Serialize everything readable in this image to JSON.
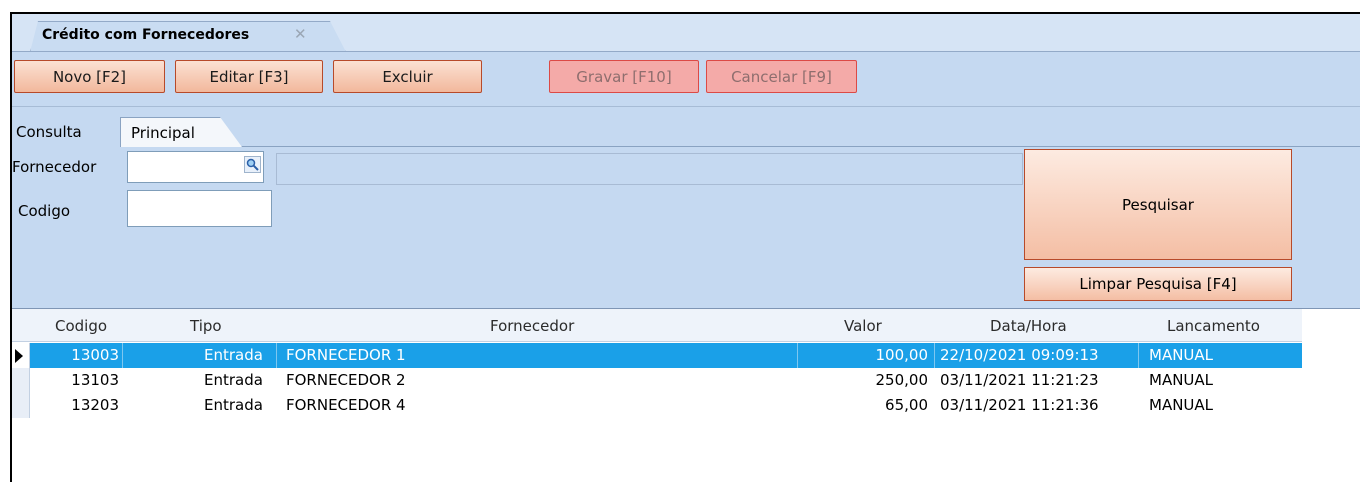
{
  "document_tab": {
    "title": "Crédito com Fornecedores",
    "close_glyph": "✕"
  },
  "toolbar": {
    "novo": "Novo [F2]",
    "editar": "Editar [F3]",
    "excluir": "Excluir",
    "gravar": "Gravar [F10]",
    "cancelar": "Cancelar [F9]"
  },
  "subtabs": {
    "consulta": "Consulta",
    "principal": "Principal"
  },
  "search": {
    "fornecedor_label": "Fornecedor",
    "fornecedor_value": "",
    "codigo_label": "Codigo",
    "codigo_value": "",
    "pesquisar": "Pesquisar",
    "limpar": "Limpar Pesquisa [F4]"
  },
  "grid": {
    "columns": [
      "Codigo",
      "Tipo",
      "Fornecedor",
      "Valor",
      "Data/Hora",
      "Lancamento"
    ],
    "rows": [
      {
        "codigo": "13003",
        "tipo": "Entrada",
        "fornecedor": "FORNECEDOR 1",
        "valor": "100,00",
        "datahora": "22/10/2021 09:09:13",
        "lancamento": "MANUAL"
      },
      {
        "codigo": "13103",
        "tipo": "Entrada",
        "fornecedor": "FORNECEDOR 2",
        "valor": "250,00",
        "datahora": "03/11/2021 11:21:23",
        "lancamento": "MANUAL"
      },
      {
        "codigo": "13203",
        "tipo": "Entrada",
        "fornecedor": "FORNECEDOR 4",
        "valor": "65,00",
        "datahora": "03/11/2021 11:21:36",
        "lancamento": "MANUAL"
      }
    ]
  },
  "colors": {
    "accent_blue": "#1aa0e8",
    "panel": "#c5d9f1",
    "button_border": "#b74a2a",
    "disabled_button": "#f4aaa8"
  }
}
